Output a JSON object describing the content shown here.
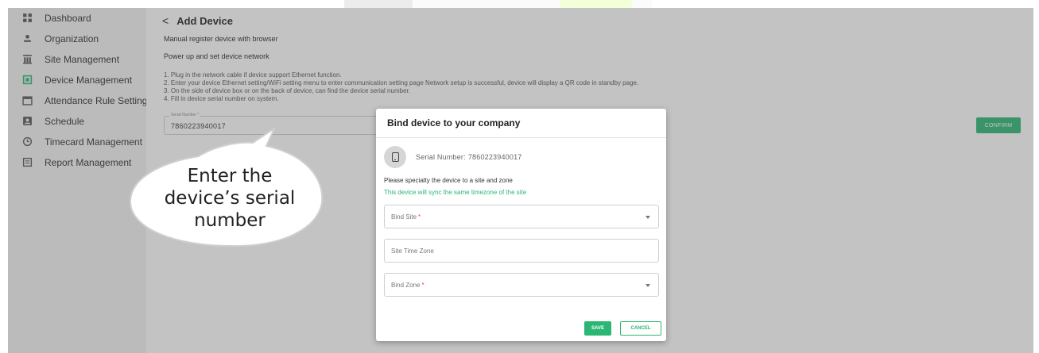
{
  "sidebar": {
    "items": [
      {
        "label": "Dashboard",
        "icon": "dashboard-grid-icon"
      },
      {
        "label": "Organization",
        "icon": "person-icon"
      },
      {
        "label": "Site Management",
        "icon": "building-icon"
      },
      {
        "label": "Device Management",
        "icon": "device-icon",
        "active": true
      },
      {
        "label": "Attendance Rule Setting",
        "icon": "calendar-icon"
      },
      {
        "label": "Schedule",
        "icon": "schedule-icon"
      },
      {
        "label": "Timecard Management",
        "icon": "clock-icon"
      },
      {
        "label": "Report Management",
        "icon": "report-icon"
      }
    ]
  },
  "page": {
    "back_glyph": "<",
    "title": "Add Device",
    "subtitle": "Manual register device with browser",
    "section": "Power up and set device network",
    "steps": [
      "1. Plug in the network cable if device support Ethernet function.",
      "2. Enter your device Ethernet setting/WiFi setting menu to enter communication setting page Network setup is successful, device will display a QR code in standby page.",
      "3. On the side of device box or on the back of device, can find the device serial number.",
      "4. Fill in device serial number on system."
    ],
    "serial_field": {
      "label": "Serial Number *",
      "value": "7860223940017"
    },
    "confirm_label": "CONFIRM"
  },
  "callout": {
    "lines": [
      "Enter the",
      "device’s serial",
      "number"
    ]
  },
  "modal": {
    "title": "Bind device to your company",
    "serial_prefix": "Serial Number:",
    "serial_value": "7860223940017",
    "hint": "Please specialty the device to a site and zone",
    "sync_note": "This device will sync the same timezone of the site",
    "bind_site_label": "Bind Site",
    "site_time_zone_label": "Site Time Zone",
    "bind_zone_label": "Bind Zone",
    "required_mark": "*",
    "save_label": "SAVE",
    "cancel_label": "CANCEL"
  },
  "colors": {
    "accent": "#2bb673",
    "required": "#e04848",
    "overlay": "#5a5a5a"
  }
}
